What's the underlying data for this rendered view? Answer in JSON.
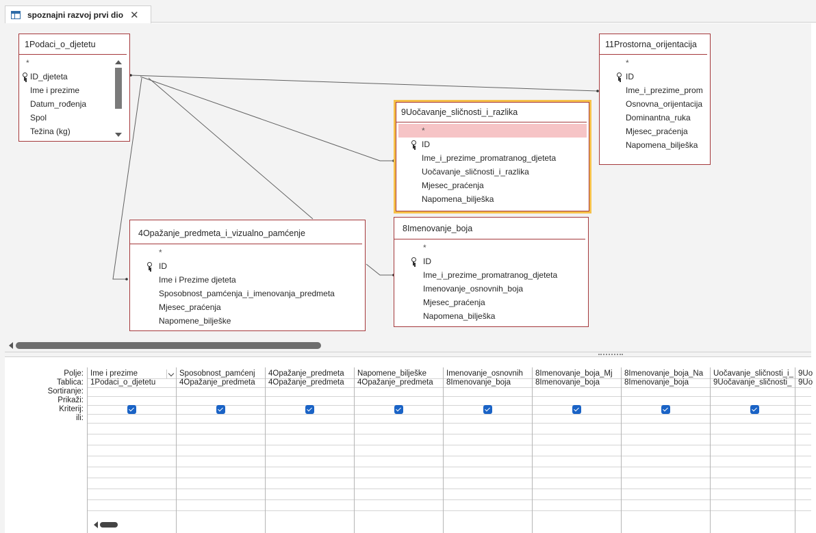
{
  "tab": {
    "title": "spoznajni razvoj prvi dio",
    "close": "✕"
  },
  "colors": {
    "table_border": "#a4373a",
    "selected_border": "#f6c14a",
    "highlight_row": "#f6c4c6",
    "checkbox": "#1a63c6",
    "canvas": "#f3f3f3"
  },
  "tables": [
    {
      "title": "1Podaci_o_djetetu",
      "fields": [
        "*",
        "ID_djeteta",
        "Ime i prezime",
        "Datum_rođenja",
        "Spol",
        "Težina (kg)"
      ],
      "key": "ID_djeteta"
    },
    {
      "title": "11Prostorna_orijentacija",
      "fields": [
        "*",
        "ID",
        "Ime_i_prezime_prom",
        "Osnovna_orijentacija",
        "Dominantna_ruka",
        "Mjesec_praćenja",
        "Napomena_bilješka"
      ],
      "key": "ID"
    },
    {
      "title": "9Uočavanje_sličnosti_i_razlika",
      "fields": [
        "*",
        "ID",
        "Ime_i_prezime_promatranog_djeteta",
        "Uočavanje_sličnosti_i_razlika",
        "Mjesec_praćenja",
        "Napomena_bilješka"
      ],
      "key": "ID"
    },
    {
      "title": "4Opažanje_predmeta_i_vizualno_pamćenje",
      "fields": [
        "*",
        "ID",
        "Ime i Prezime djeteta",
        "Sposobnost_pamćenja_i_imenovanja_predmeta",
        "Mjesec_praćenja",
        "Napomene_bilješke"
      ],
      "key": "ID"
    },
    {
      "title": "8Imenovanje_boja",
      "fields": [
        "*",
        "ID",
        "Ime_i_prezime_promatranog_djeteta",
        "Imenovanje_osnovnih_boja",
        "Mjesec_praćenja",
        "Napomena_bilješka"
      ],
      "key": "ID"
    }
  ],
  "grid": {
    "row_labels": [
      "Polje:",
      "Tablica:",
      "Sortiranje:",
      "Prikaži:",
      "Kriterij:",
      "ili:"
    ],
    "columns": [
      {
        "field": "Ime i prezime",
        "table": "1Podaci_o_djetetu",
        "show": true
      },
      {
        "field": "Sposobnost_pamćenj",
        "table": "4Opažanje_predmeta",
        "show": true
      },
      {
        "field": "4Opažanje_predmeta",
        "table": "4Opažanje_predmeta",
        "show": true
      },
      {
        "field": "Napomene_bilješke",
        "table": "4Opažanje_predmeta",
        "show": true
      },
      {
        "field": "Imenovanje_osnovnih",
        "table": "8Imenovanje_boja",
        "show": true
      },
      {
        "field": "8Imenovanje_boja_Mj",
        "table": "8Imenovanje_boja",
        "show": true
      },
      {
        "field": "8Imenovanje_boja_Na",
        "table": "8Imenovanje_boja",
        "show": true
      },
      {
        "field": "Uočavanje_sličnosti_i_",
        "table": "9Uočavanje_sličnosti_",
        "show": true
      },
      {
        "field": "9Uo",
        "table": "9Uo",
        "show": false
      }
    ]
  }
}
